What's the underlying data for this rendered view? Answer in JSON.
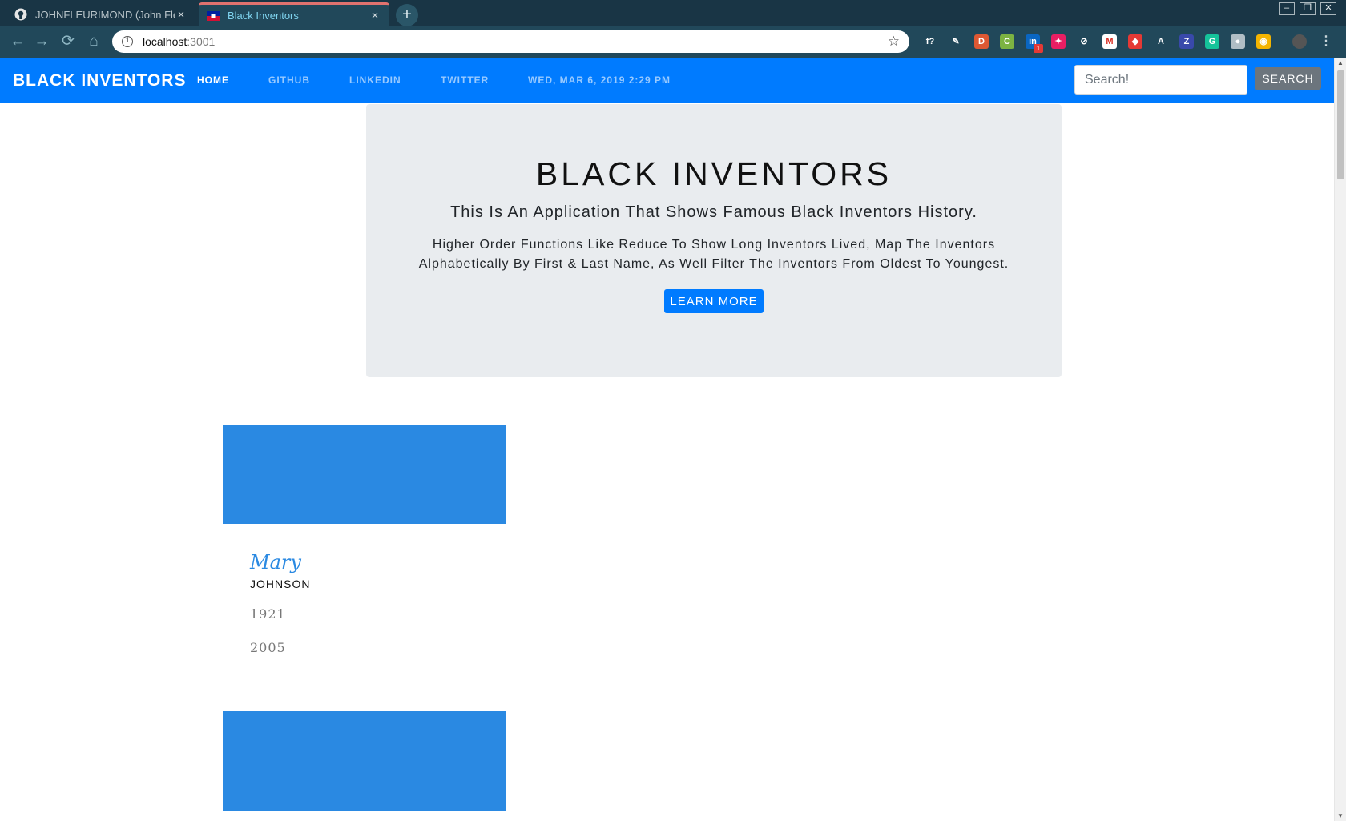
{
  "browser": {
    "tabs": [
      {
        "title": "JOHNFLEURIMOND (John Fleuri",
        "active": false
      },
      {
        "title": "Black Inventors",
        "active": true
      }
    ],
    "new_tab": "+",
    "window": {
      "minimize": "–",
      "restore": "❐",
      "close": "✕"
    },
    "nav": {
      "back": "←",
      "forward": "→",
      "reload": "⟳",
      "home": "⌂"
    },
    "address": {
      "host": "localhost",
      "port": ":3001"
    },
    "star": "☆",
    "extensions": [
      {
        "name": "fx-icon",
        "label": "f?",
        "color": "#21485a"
      },
      {
        "name": "pen-icon",
        "label": "✎",
        "color": "#21485a"
      },
      {
        "name": "duckduckgo-icon",
        "label": "D",
        "color": "#de5833"
      },
      {
        "name": "cors-icon",
        "label": "C",
        "color": "#7cb342"
      },
      {
        "name": "linkedin-icon",
        "label": "in",
        "color": "#0a66c2"
      },
      {
        "name": "bird-icon",
        "label": "✦",
        "color": "#e91e63"
      },
      {
        "name": "block-icon",
        "label": "⊘",
        "color": "#21485a"
      },
      {
        "name": "gmail-icon",
        "label": "M",
        "color": "#ffffff"
      },
      {
        "name": "puzzle-icon",
        "label": "◆",
        "color": "#e53935"
      },
      {
        "name": "circle-a-icon",
        "label": "A",
        "color": "#21485a"
      },
      {
        "name": "z-icon",
        "label": "Z",
        "color": "#3949ab"
      },
      {
        "name": "grammarly-icon",
        "label": "G",
        "color": "#15c39a"
      },
      {
        "name": "globe-icon",
        "label": "●",
        "color": "#b0bec5"
      },
      {
        "name": "chrome-icon",
        "label": "◉",
        "color": "#f4b400"
      }
    ],
    "linkedin_badge": "1"
  },
  "navbar": {
    "brand": "BLACK INVENTORS",
    "links": [
      "HOME",
      "GITHUB",
      "LINKEDIN",
      "TWITTER"
    ],
    "date": "WED, MAR 6, 2019 2:29 PM",
    "search_placeholder": "Search!",
    "search_button": "SEARCH"
  },
  "jumbotron": {
    "title": "BLACK INVENTORS",
    "subtitle": "This Is An Application That Shows Famous Black Inventors History.",
    "description": "Higher Order Functions Like Reduce To Show Long Inventors Lived, Map The Inventors Alphabetically By First & Last Name, As Well Filter The Inventors From Oldest To Youngest.",
    "button": "LEARN MORE"
  },
  "inventors": [
    {
      "first": "Mary",
      "last": "JOHNSON",
      "born": "1921",
      "died": "2005"
    }
  ],
  "colors": {
    "primary": "#007bff",
    "card": "#2a89e2",
    "jumbotron": "#e9ecef"
  }
}
